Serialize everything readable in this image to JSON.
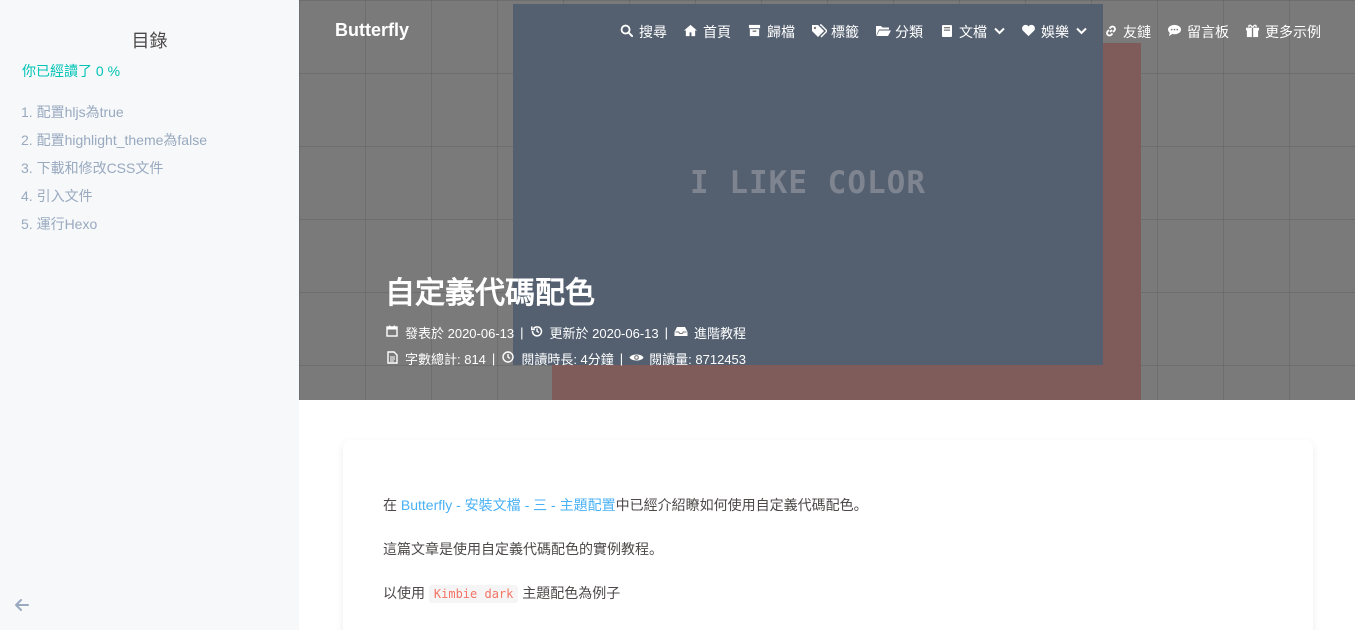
{
  "toc": {
    "title": "目錄",
    "progress": "你已經讀了 0 %",
    "items": [
      "1. 配置hljs為true",
      "2. 配置highlight_theme為false",
      "3. 下載和修改CSS文件",
      "4. 引入文件",
      "5. 運行Hexo"
    ]
  },
  "header": {
    "brand": "Butterfly",
    "cover_text": "I LIKE COLOR",
    "nav": [
      {
        "label": "搜尋",
        "icon": "search-icon"
      },
      {
        "label": "首頁",
        "icon": "home-icon"
      },
      {
        "label": "歸檔",
        "icon": "archive-icon"
      },
      {
        "label": "標籤",
        "icon": "tags-icon"
      },
      {
        "label": "分類",
        "icon": "folder-icon"
      },
      {
        "label": "文檔",
        "icon": "book-icon"
      },
      {
        "label": "娛樂",
        "icon": "heart-icon"
      },
      {
        "label": "友鏈",
        "icon": "link-icon"
      },
      {
        "label": "留言板",
        "icon": "comment-icon"
      },
      {
        "label": "更多示例",
        "icon": "gift-icon"
      }
    ]
  },
  "post": {
    "title": "自定義代碼配色",
    "published": "發表於 2020-06-13",
    "updated": "更新於 2020-06-13",
    "category": "進階教程",
    "wordcount": "字數總計: 814",
    "reading_time": "閱讀時長: 4分鐘",
    "views": "閱讀量: 8712453"
  },
  "content": {
    "p1_prefix": "在",
    "p1_link": "Butterfly - 安裝文檔 - 三 - 主題配置",
    "p1_suffix": "中已經介紹瞭如何使用自定義代碼配色。",
    "p2": "這篇文章是使用自定義代碼配色的實例教程。",
    "p3_prefix": "以使用",
    "p3_code": "Kimbie dark",
    "p3_suffix": "主題配色為例子"
  },
  "colors": {
    "accent": "#49b1f5",
    "toc_progress": "#00c4b6",
    "code": "#f47466"
  }
}
